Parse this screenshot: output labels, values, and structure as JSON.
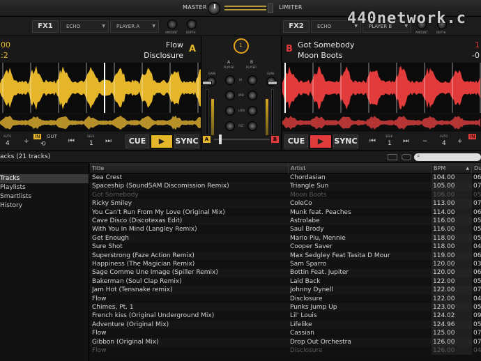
{
  "topbar": {
    "master": "MASTER",
    "limiter": "LIMITER"
  },
  "watermark": "440network.c",
  "fx": {
    "left": {
      "label": "FX1",
      "effect": "ECHO",
      "target": "PLAYER A",
      "knob1": "AMOUNT",
      "knob2": "DEPTH"
    },
    "right": {
      "label": "FX2",
      "effect": "ECHO",
      "target": "PLAYER B",
      "knob1": "AMOUNT",
      "knob2": "DEPTH"
    }
  },
  "deckA": {
    "letter": "A",
    "title": "Flow",
    "artist": "Disclosure",
    "edge_top": "00",
    "edge_bottom": ":2",
    "loop": "4",
    "loop_label": "AUTO",
    "in": "IN",
    "out": "OUT",
    "seek": "1",
    "seek_label": "SEEK",
    "cue": "CUE",
    "sync": "SYNC",
    "color": "#e6b62a"
  },
  "deckB": {
    "letter": "B",
    "title": "Got Somebody",
    "artist": "Moon Boots",
    "edge_top": "1",
    "edge_bottom": "-0",
    "loop": "4",
    "loop_label": "AUTO",
    "in": "IN",
    "seek": "1",
    "seek_label": "SEEK",
    "cue": "CUE",
    "sync": "SYNC",
    "color": "#e23b3b"
  },
  "mixer": {
    "a_label": "A",
    "b_label": "B",
    "a_sub": "PLAYER",
    "b_sub": "PLAYER",
    "gain": "GAIN",
    "hi": "HI",
    "mid": "MID",
    "low": "LOW",
    "filt": "FILT",
    "xfade_a": "A",
    "xfade_b": "B",
    "center": "1"
  },
  "browser": {
    "header": "acks (21 tracks)"
  },
  "sidebar": {
    "items": [
      "Tracks",
      "Playlists",
      "Smartlists",
      "History"
    ]
  },
  "table": {
    "headers": {
      "title": "Title",
      "artist": "Artist",
      "bpm": "BPM",
      "dur": "Du"
    },
    "rows": [
      {
        "title": "Sea Crest",
        "artist": "Chordasian",
        "bpm": "104.00",
        "dur": "06"
      },
      {
        "title": "Spaceship (SoundSAM Discomission Remix)",
        "artist": "Triangle Sun",
        "bpm": "105.00",
        "dur": "07"
      },
      {
        "title": "Got Somebody",
        "artist": "Moon Boots",
        "bpm": "106.00",
        "dur": "05",
        "dim": true
      },
      {
        "title": "Ricky Smiley",
        "artist": "ColeCo",
        "bpm": "113.00",
        "dur": "07"
      },
      {
        "title": "You Can't Run From My Love (Original Mix)",
        "artist": "Munk feat. Peaches",
        "bpm": "114.00",
        "dur": "06"
      },
      {
        "title": "Cave Disco (Discotexas Edit)",
        "artist": "Astrolabe",
        "bpm": "116.00",
        "dur": "05"
      },
      {
        "title": "With You In Mind (Langley Remix)",
        "artist": "Saul Brody",
        "bpm": "116.00",
        "dur": "05"
      },
      {
        "title": "Get Enough",
        "artist": "Mario Piu, Mennie",
        "bpm": "118.00",
        "dur": "05"
      },
      {
        "title": "Sure Shot",
        "artist": "Cooper Saver",
        "bpm": "118.00",
        "dur": "04"
      },
      {
        "title": "Superstrong (Faze Action Remix)",
        "artist": "Max Sedgley Feat Tasita D Mour",
        "bpm": "119.00",
        "dur": "06"
      },
      {
        "title": "Happiness (The Magician Remix)",
        "artist": "Sam Sparro",
        "bpm": "120.00",
        "dur": "03"
      },
      {
        "title": "Sage Comme Une Image (Spiller Remix)",
        "artist": "Bottin Feat. Jupiter",
        "bpm": "120.00",
        "dur": "06"
      },
      {
        "title": "Bakerman (Soul Clap Remix)",
        "artist": "Laid Back",
        "bpm": "122.00",
        "dur": "05"
      },
      {
        "title": "Jam Hot (Tensnake remix)",
        "artist": "Johnny Dynell",
        "bpm": "122.00",
        "dur": "07"
      },
      {
        "title": "Flow",
        "artist": "Disclosure",
        "bpm": "122.00",
        "dur": "04"
      },
      {
        "title": "Chimes, Pt. 1",
        "artist": "Punks Jump Up",
        "bpm": "123.00",
        "dur": "05"
      },
      {
        "title": "French kiss (Original Underground Mix)",
        "artist": "Lil' Louis",
        "bpm": "124.02",
        "dur": "09"
      },
      {
        "title": "Adventure (Original Mix)",
        "artist": "Lifelike",
        "bpm": "124.96",
        "dur": "05"
      },
      {
        "title": "Flow",
        "artist": "Cassian",
        "bpm": "125.00",
        "dur": "07"
      },
      {
        "title": "Gibbon (Original Mix)",
        "artist": "Drop Out Orchestra",
        "bpm": "126.00",
        "dur": "07"
      },
      {
        "title": "Flow",
        "artist": "Disclosure",
        "bpm": "126.00",
        "dur": "04",
        "dim": true
      }
    ]
  }
}
